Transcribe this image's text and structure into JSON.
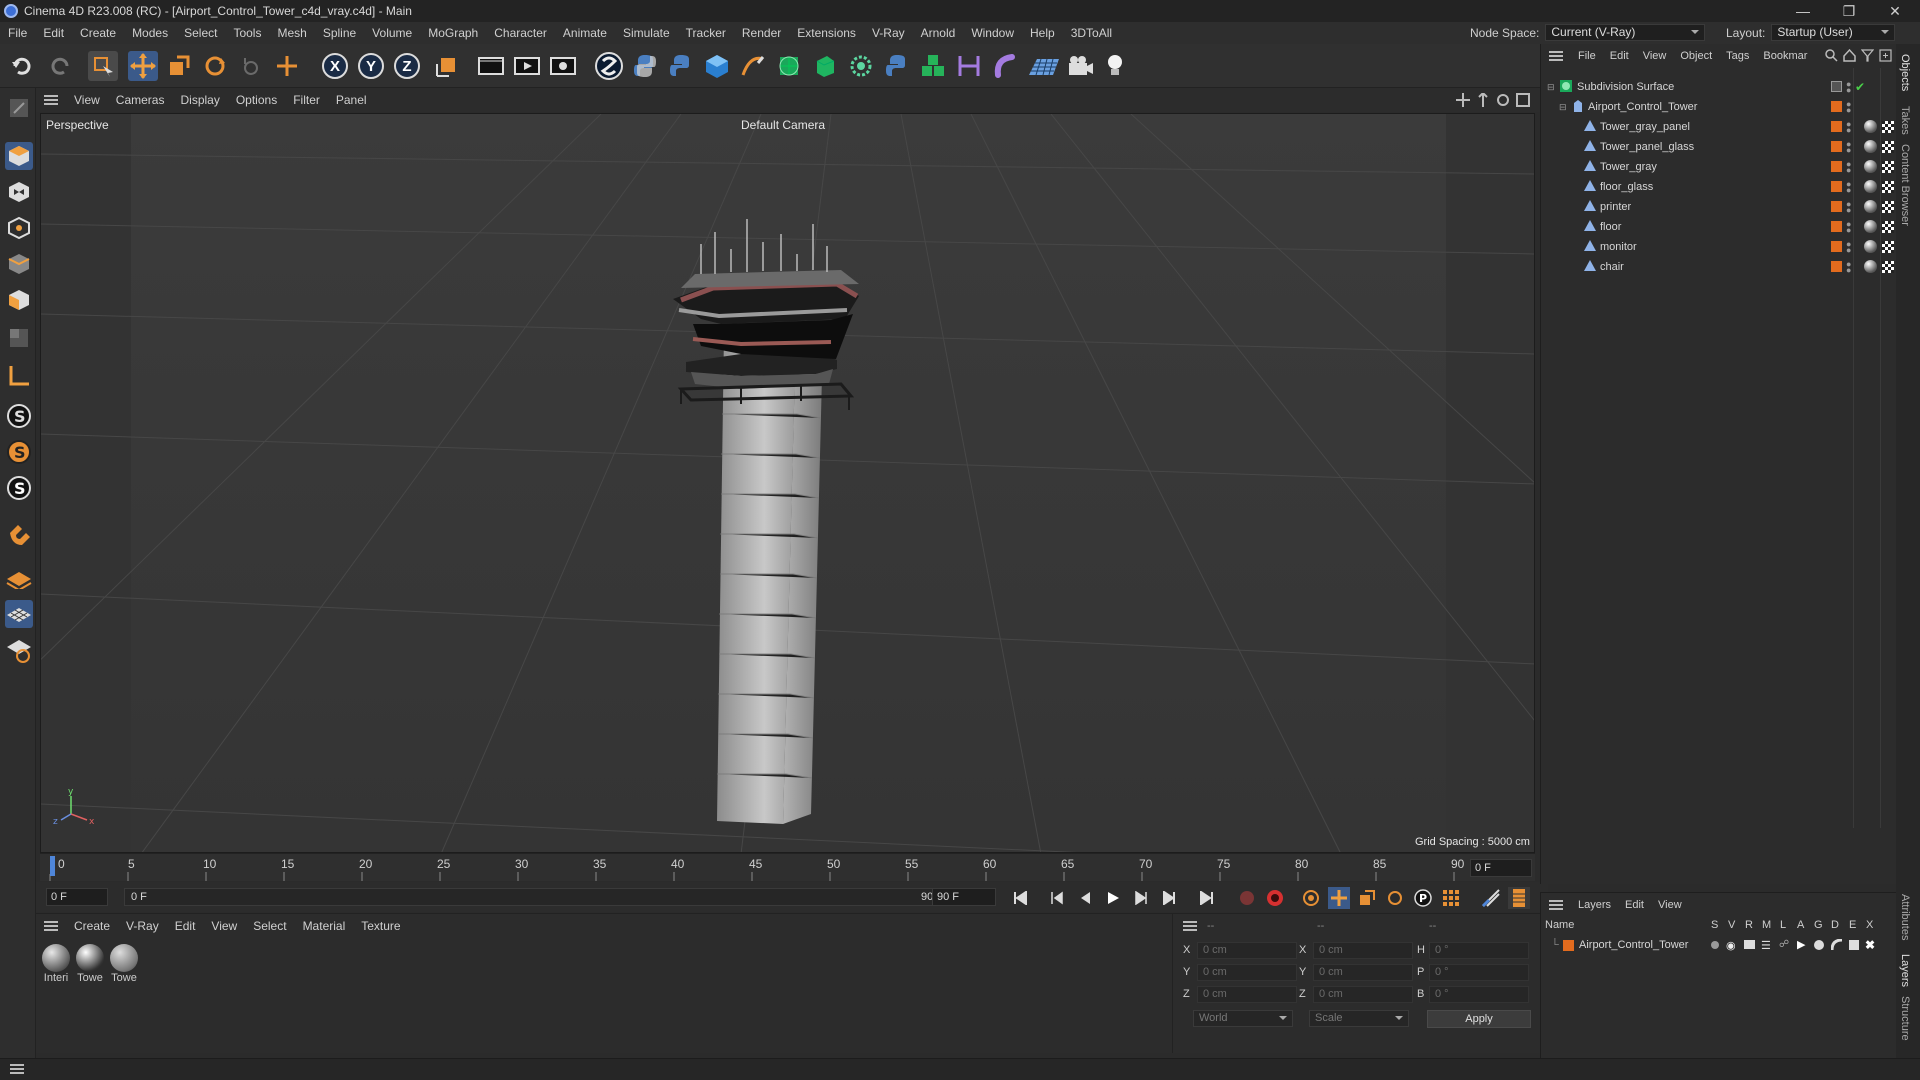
{
  "window": {
    "title": "Cinema 4D R23.008 (RC) - [Airport_Control_Tower_c4d_vray.c4d] - Main"
  },
  "menu": [
    "File",
    "Edit",
    "Create",
    "Modes",
    "Select",
    "Tools",
    "Mesh",
    "Spline",
    "Volume",
    "MoGraph",
    "Character",
    "Animate",
    "Simulate",
    "Tracker",
    "Render",
    "Extensions",
    "V-Ray",
    "Arnold",
    "Window",
    "Help",
    "3DToAll"
  ],
  "nodespace": {
    "label": "Node Space:",
    "value": "Current (V-Ray)"
  },
  "layout": {
    "label": "Layout:",
    "value": "Startup (User)"
  },
  "viewport_menu": [
    "View",
    "Cameras",
    "Display",
    "Options",
    "Filter",
    "Panel"
  ],
  "viewport": {
    "name": "Perspective",
    "camera": "Default Camera",
    "grid": "Grid Spacing : 5000 cm"
  },
  "timeline": {
    "ticks": [
      "0",
      "5",
      "10",
      "15",
      "20",
      "25",
      "30",
      "35",
      "40",
      "45",
      "50",
      "55",
      "60",
      "65",
      "70",
      "75",
      "80",
      "85",
      "90"
    ],
    "current": "0 F"
  },
  "playback": {
    "start": "0 F",
    "range_start": "0 F",
    "range_end": "90 F",
    "end": "90 F"
  },
  "material_menu": [
    "Create",
    "V-Ray",
    "Edit",
    "View",
    "Select",
    "Material",
    "Texture"
  ],
  "materials": [
    "Interi",
    "Towe",
    "Towe"
  ],
  "coords": {
    "header": [
      "--",
      "--",
      "--"
    ],
    "rows": [
      {
        "a": "X",
        "av": "0 cm",
        "b": "X",
        "bv": "0 cm",
        "c": "H",
        "cv": "0 °"
      },
      {
        "a": "Y",
        "av": "0 cm",
        "b": "Y",
        "bv": "0 cm",
        "c": "P",
        "cv": "0 °"
      },
      {
        "a": "Z",
        "av": "0 cm",
        "b": "Z",
        "bv": "0 cm",
        "c": "B",
        "cv": "0 °"
      }
    ],
    "world": "World",
    "scale": "Scale",
    "apply": "Apply"
  },
  "objects_menu": [
    "File",
    "Edit",
    "View",
    "Object",
    "Tags",
    "Bookmar"
  ],
  "objects": {
    "root": "Subdivision Surface",
    "group": "Airport_Control_Tower",
    "children": [
      "Tower_gray_panel",
      "Tower_panel_glass",
      "Tower_gray",
      "floor_glass",
      "printer",
      "floor",
      "monitor",
      "chair"
    ]
  },
  "layers_menu": [
    "Layers",
    "Edit",
    "View"
  ],
  "layers": {
    "columns": [
      "Name",
      "S",
      "V",
      "R",
      "M",
      "L",
      "A",
      "G",
      "D",
      "E",
      "X"
    ],
    "rows": [
      "Airport_Control_Tower"
    ]
  },
  "side_tabs": [
    "Objects",
    "Takes",
    "Content Browser",
    "Attributes",
    "Layers",
    "Structure"
  ],
  "colors": {
    "accent": "#e26b1e",
    "viewport_bg": "#3a3a3a"
  }
}
